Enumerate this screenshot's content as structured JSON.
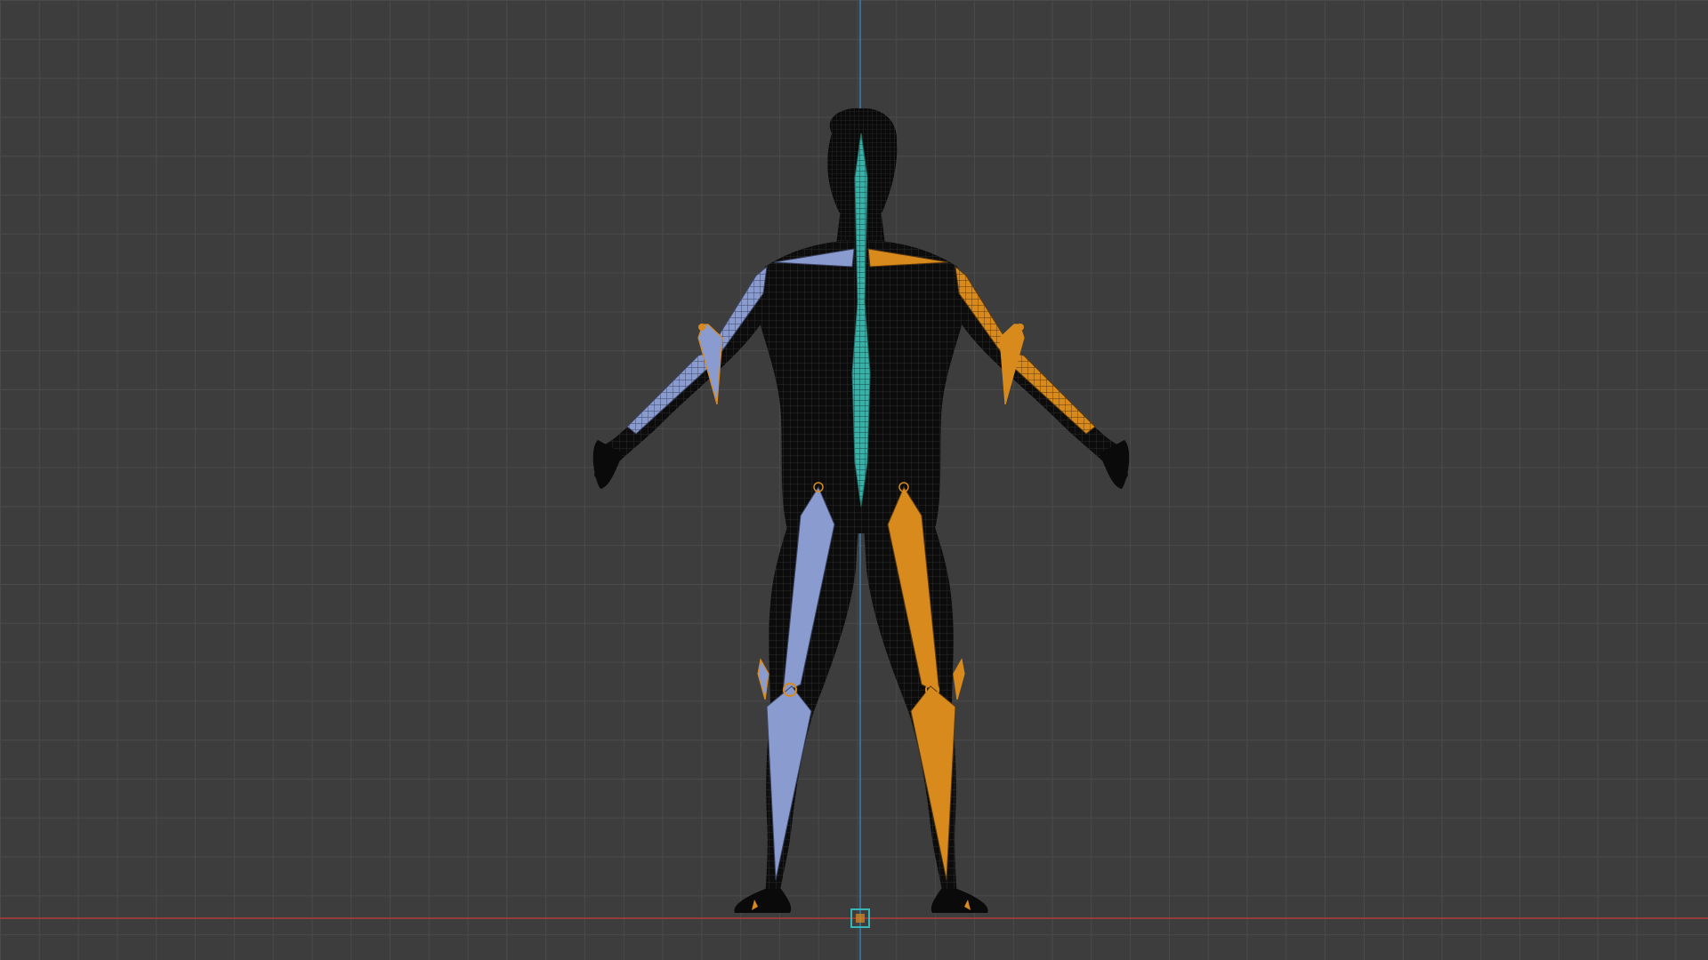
{
  "viewport": {
    "view": "front-orthographic",
    "shading": "wireframe",
    "grid": true,
    "colors": {
      "background": "#3d3d3d",
      "grid_line": "#4a4a4a",
      "x_axis": "#b23b3b",
      "z_axis": "#3a7fb5",
      "mesh_fill": "#0c0c0c",
      "mesh_wire": "#262626",
      "bone_left": "#8a9bd0",
      "bone_right": "#d88a1c",
      "bone_center": "#36b2a8",
      "origin_gizmo": "#38b6b6"
    }
  },
  "scene": {
    "mesh": {
      "name_icon": "character-mesh",
      "pose": "A-pose"
    },
    "armature": {
      "bones": [
        {
          "name_icon": "spine-bone",
          "side": "center"
        },
        {
          "name_icon": "upper-arm-bone",
          "side": "left"
        },
        {
          "name_icon": "forearm-bone",
          "side": "left"
        },
        {
          "name_icon": "upper-arm-bone",
          "side": "right"
        },
        {
          "name_icon": "forearm-bone",
          "side": "right"
        },
        {
          "name_icon": "thigh-bone",
          "side": "left"
        },
        {
          "name_icon": "shin-bone",
          "side": "left"
        },
        {
          "name_icon": "thigh-bone",
          "side": "right"
        },
        {
          "name_icon": "shin-bone",
          "side": "right"
        },
        {
          "name_icon": "elbow-pole-target",
          "side": "left"
        },
        {
          "name_icon": "elbow-pole-target",
          "side": "right"
        },
        {
          "name_icon": "knee-pole-target",
          "side": "left"
        },
        {
          "name_icon": "knee-pole-target",
          "side": "right"
        }
      ]
    },
    "origin_icon": "origin-gizmo-icon"
  }
}
